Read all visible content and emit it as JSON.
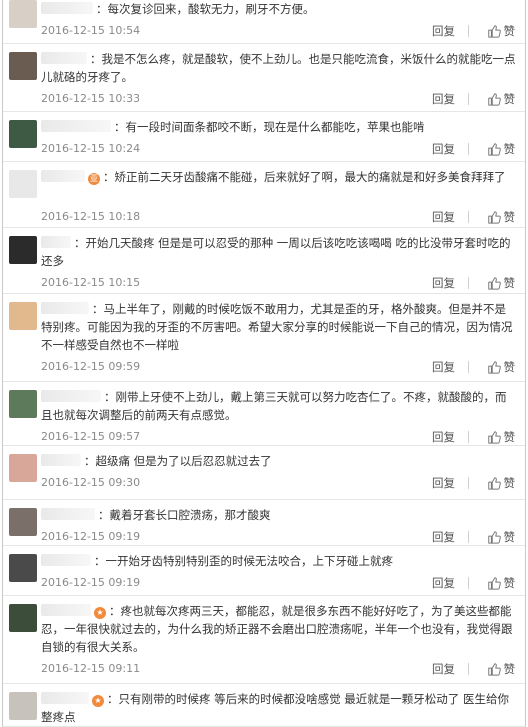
{
  "reply_label": "回复",
  "like_label": "赞",
  "comments": [
    {
      "uname_w": 52,
      "badge": "",
      "text": "每次复诊回来，酸软无力，刷牙不方便。",
      "time": "2016-12-15 10:54",
      "av": "#d8cfc6"
    },
    {
      "uname_w": 46,
      "badge": "",
      "text": "我是不怎么疼，就是酸软，使不上劲儿。也是只能吃流食，米饭什么的就能吃一点儿就硌的牙疼了。",
      "time": "2016-12-15 10:33",
      "av": "#6b5c52"
    },
    {
      "uname_w": 70,
      "badge": "",
      "text": "有一段时间面条都咬不断，现在是什么都能吃，苹果也能啃",
      "time": "2016-12-15 10:24",
      "av": "#3f5a44"
    },
    {
      "uname_w": 44,
      "badge": "亚",
      "text": "矫正前二天牙齿酸痛不能碰，后来就好了啊，最大的痛就是和好多美食拜拜了",
      "time": "2016-12-15 10:18",
      "av": "#e8e8e8"
    },
    {
      "uname_w": 30,
      "badge": "",
      "text": "开始几天酸疼 但是是可以忍受的那种 一周以后该吃吃该喝喝 吃的比没带牙套时吃的还多",
      "time": "2016-12-15 10:15",
      "av": "#2b2b2b"
    },
    {
      "uname_w": 48,
      "badge": "",
      "text": "马上半年了，刚戴的时候吃饭不敢用力，尤其是歪的牙，格外酸爽。但是并不是特别疼。可能因为我的牙歪的不厉害吧。希望大家分享的时候能说一下自己的情况，因为情况不一样感受自然也不一样啦",
      "time": "2016-12-15 09:59",
      "av": "#e2b98d"
    },
    {
      "uname_w": 60,
      "badge": "",
      "text": "刚带上牙使不上劲儿，戴上第三天就可以努力吃杏仁了。不疼，就酸酸的，而且也就每次调整后的前两天有点感觉。",
      "time": "2016-12-15 09:57",
      "av": "#5d7a5a"
    },
    {
      "uname_w": 40,
      "badge": "",
      "text": "超级痛 但是为了以后忍忍就过去了",
      "time": "2016-12-15 09:30",
      "av": "#d9a79a"
    },
    {
      "uname_w": 54,
      "badge": "",
      "text": "戴着牙套长口腔溃疡，那才酸爽",
      "time": "2016-12-15 09:19",
      "av": "#7a6f69"
    },
    {
      "uname_w": 50,
      "badge": "",
      "text": "一开始牙齿特别特别歪的时候无法咬合，上下牙碰上就疼",
      "time": "2016-12-15 09:19",
      "av": "#4a4a4a"
    },
    {
      "uname_w": 50,
      "badge": "★",
      "text": "疼也就每次疼两三天，都能忍，就是很多东西不能好好吃了，为了美这些都能忍，一年很快就过去的，为什么我的矫正器不会磨出口腔溃疡呢，半年一个也没有，我觉得跟自锁的有很大关系。",
      "time": "2016-12-15 09:11",
      "av": "#3c4e3a"
    },
    {
      "uname_w": 48,
      "badge": "★",
      "text": "只有刚带的时候疼 等后来的时候都没啥感觉 最近就是一颗牙松动了 医生给你整疼点",
      "time": "",
      "av": "#c8c2bc"
    }
  ]
}
